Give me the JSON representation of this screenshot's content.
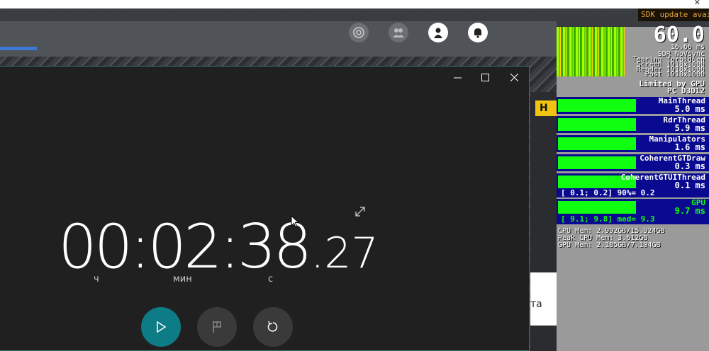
{
  "browser": {
    "close_glyph": "✕"
  },
  "sdk_banner": "SDK update avai",
  "game": {
    "nav_icons": [
      "radar-icon",
      "friends-icon",
      "profile-icon",
      "notifications-icon"
    ],
    "yellow_label": "H",
    "side_text": "та",
    "accent_color": "#3d7ad6"
  },
  "stopwatch": {
    "controls": {
      "minimize": "—",
      "maximize": "☐",
      "close": "✕"
    },
    "time": {
      "main": "00:02:38",
      "fraction": ".27"
    },
    "units": {
      "hours": "ч",
      "minutes": "мин",
      "seconds": "с"
    },
    "buttons": {
      "play": {
        "icon": "play-icon",
        "color": "#0e7c86"
      },
      "lap": {
        "icon": "flag-icon",
        "color": "#3a3a3a"
      },
      "reset": {
        "icon": "reset-icon",
        "color": "#3a3a3a"
      }
    }
  },
  "stats": {
    "fps": "60.0",
    "lines": [
      "16.66 ms",
      "SDR NoVsync",
      "Tearing forbidden",
      "Screen 1918x1000",
      "Render 1918x1000",
      "Post 1918x1000",
      "Limited by GPU",
      "PC D3D12"
    ],
    "threads": [
      {
        "name": "MainThread",
        "value": "5.0 ms",
        "fill": 0.52
      },
      {
        "name": "RdrThread",
        "value": "5.9 ms",
        "fill": 0.52
      },
      {
        "name": "Manipulators",
        "value": "1.6 ms",
        "fill": 0.52
      },
      {
        "name": "CoherentGTDraw",
        "value": "0.3 ms",
        "fill": 0.52
      },
      {
        "name": "CoherentGTUIThread",
        "value": "0.1 ms",
        "fill": 0.52
      },
      {
        "name": "GPU",
        "value": "9.7 ms",
        "fill": 0.52
      }
    ],
    "range_ui": "[ 0.1; 0.2] 90%= 0.2",
    "range_gpu": "[ 9.1; 9.8] med= 9.3",
    "memory": [
      "CPU Mem: 2.992GB/15.924GB",
      "Peak CPU Mem: 3.612GB",
      "GPU Mem: 2.185GB/7.104GB"
    ],
    "colors": {
      "bar": "#10ff10",
      "panel": "#0a0a90",
      "gpu_text": "#10ff10"
    }
  }
}
